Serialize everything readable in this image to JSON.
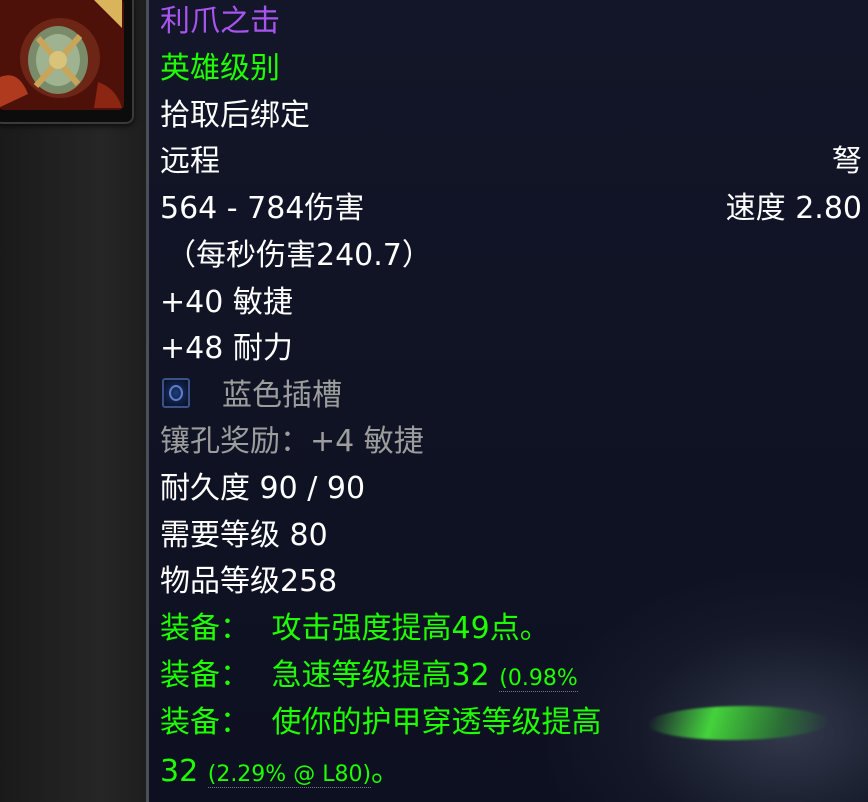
{
  "item": {
    "icon": "claw-strike-icon",
    "name": "利爪之击",
    "quality": "英雄级别",
    "binding": "拾取后绑定",
    "slot": "远程",
    "type": "弩",
    "damage": "564 - 784伤害",
    "speed": "速度 2.80",
    "dps": "（每秒伤害240.7）",
    "stats": [
      "+40 敏捷",
      "+48 耐力"
    ],
    "socket": {
      "icon": "blue-socket-icon",
      "label": "蓝色插槽"
    },
    "socket_bonus": "镶孔奖励：+4 敏捷",
    "durability": "耐久度 90 / 90",
    "required_level": "需要等级 80",
    "item_level": "物品等级258",
    "equip_effects": [
      {
        "prefix": "装备：",
        "text": "攻击强度提高49点。",
        "detail": ""
      },
      {
        "prefix": "装备：",
        "text": "急速等级提高32",
        "detail": "(0.98%"
      },
      {
        "prefix": "装备：",
        "text": "使你的护甲穿透等级提高",
        "detail": ""
      }
    ],
    "equip_continuation": {
      "value": "32",
      "detail": "(2.29% @ L80)",
      "suffix": "。"
    }
  },
  "colors": {
    "epic_purple": "#a855f0",
    "uncommon_green": "#1eff00",
    "gray": "#9d9d9d",
    "white": "#ffffff",
    "tooltip_bg": "#121628"
  }
}
